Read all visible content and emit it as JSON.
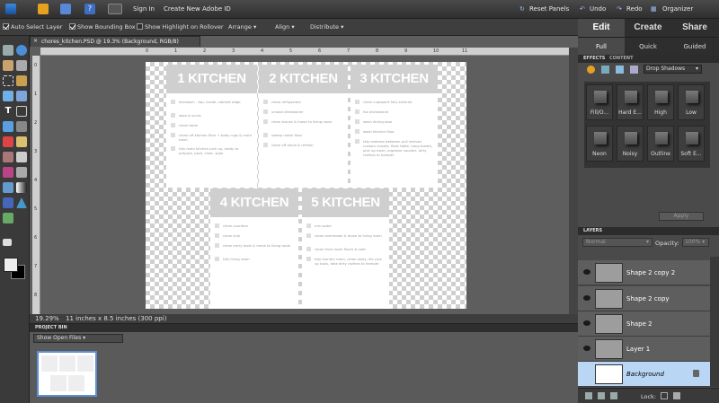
{
  "menubar": {
    "sign_in": "Sign In",
    "create_id": "Create New Adobe ID",
    "reset_panels": "Reset Panels",
    "undo": "Undo",
    "redo": "Redo",
    "organizer": "Organizer"
  },
  "options": {
    "auto_select": "Auto Select Layer",
    "bounding_box": "Show Bounding Box",
    "highlight": "Show Highlight on Rollover",
    "arrange": "Arrange",
    "align": "Align",
    "distribute": "Distribute"
  },
  "document": {
    "tab_title": "chores_kitchen.PSD @ 19.3% (Background, RGB/8)",
    "zoom": "19.29%",
    "size_info": "11 inches x 8.5 inches (300 ppi)",
    "ruler_top": [
      "0",
      "1",
      "2",
      "3",
      "4",
      "5",
      "6",
      "7",
      "8",
      "9",
      "10",
      "11"
    ],
    "ruler_left": [
      "0",
      "1",
      "2",
      "3",
      "4",
      "5",
      "6",
      "7",
      "8"
    ]
  },
  "cards": [
    {
      "title": "1 KITCHEN",
      "items": [
        "dishwash - top, inside, cabinet edge",
        "wipe & scrub",
        "clean table",
        "clean off kitchen floor + baby rugs & more trash",
        "tidy main kitchen pick up, ready to prepare, pack, clear, wipe"
      ]
    },
    {
      "title": "2 KITCHEN",
      "items": [
        "clean refrigerator",
        "unload dishwasher",
        "clean stoves & move to living room",
        "sweep under floor",
        "clean off stove & refresh"
      ]
    },
    {
      "title": "3 KITCHEN",
      "items": [
        "clean cupboard fully exterior",
        "fox dishwasher",
        "wash dining door",
        "wash kitchen floor",
        "tidy sadness between pull shelves custom closets, flash table, hang towels, pick up trash, organize counter, dirty clothes to hamper"
      ]
    },
    {
      "title": "4 KITCHEN",
      "items": [
        "clean counters",
        "clean sink",
        "clean entry tools & move to living room",
        "tidy living room"
      ]
    },
    {
      "title": "5 KITCHEN",
      "items": [
        "mix water",
        "clean overheads & move to living room",
        "clean front room floors & sofa",
        "tidy laundry room, clean away, etc pick up tools, take dirty clothes to hamper"
      ]
    }
  ],
  "project_bin": {
    "header": "PROJECT BIN",
    "dropdown": "Show Open Files"
  },
  "panel": {
    "tabs": [
      "Edit",
      "Create",
      "Share"
    ],
    "subtabs": [
      "Full",
      "Quick",
      "Guided"
    ],
    "effects_tabs": [
      "EFFECTS",
      "CONTENT"
    ],
    "effects_dropdown": "Drop Shadows",
    "effects": [
      "Fill/O...",
      "Hard E...",
      "High",
      "Low",
      "Neon",
      "Noisy",
      "Outline",
      "Soft E..."
    ],
    "apply": "Apply"
  },
  "layers": {
    "header": "LAYERS",
    "blend_mode": "Normal",
    "opacity_label": "Opacity:",
    "opacity_value": "100%",
    "lock_label": "Lock:",
    "items": [
      "Shape 2 copy 2",
      "Shape 2 copy",
      "Shape 2",
      "Layer 1",
      "Background"
    ]
  },
  "colors": {
    "accent": "#b9d6f5",
    "card_header": "#cfcfcf"
  }
}
